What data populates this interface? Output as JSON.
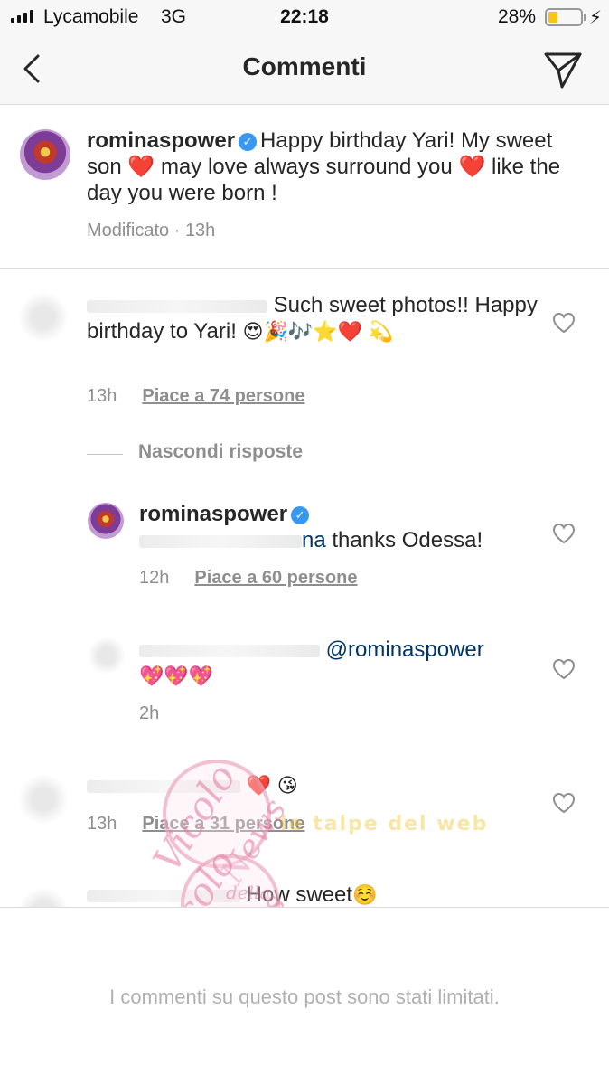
{
  "status_bar": {
    "carrier": "Lycamobile",
    "network": "3G",
    "time": "22:18",
    "battery": "28%",
    "battery_level": 0.28
  },
  "header": {
    "title": "Commenti",
    "back_icon": "chevron-left-icon",
    "send_icon": "paper-plane-icon"
  },
  "caption": {
    "username": "rominaspower",
    "text_1": "Happy birthday Yari! My sweet son",
    "text_2": "may love always surround you",
    "text_3": "like the day you were born !",
    "edited": "Modificato",
    "time": "13h"
  },
  "comments": [
    {
      "text_1": "Such sweet photos!!",
      "text_2": "Happy birthday to Yari!",
      "emoji": "😍🎉🎶⭐",
      "emoji_2": "💫",
      "time": "13h",
      "likes": "Piace a 74 persone"
    },
    {
      "hide_replies": "Nascondi risposte"
    },
    {
      "username": "rominaspower",
      "mention_tail": "na",
      "text": "thanks Odessa!",
      "time": "12h",
      "likes": "Piace a 60 persone"
    },
    {
      "mention": "@rominaspower",
      "emoji": "💖💖💖",
      "time": "2h"
    },
    {
      "emoji": "😘",
      "time": "13h",
      "likes": "Piace a 31 persone"
    },
    {
      "text": "How sweet",
      "emoji": "☺️"
    }
  ],
  "footer": {
    "text": "I commenti su questo post sono stati limitati."
  },
  "watermarks": {
    "vicolo": "Vicolo",
    "news": "News",
    "della": "della",
    "talpe": "le talpe del web"
  },
  "colors": {
    "verified": "#3897f0",
    "heart": "#e0245e",
    "meta_gray": "#8e8e8e",
    "battery": "#f5c518"
  }
}
